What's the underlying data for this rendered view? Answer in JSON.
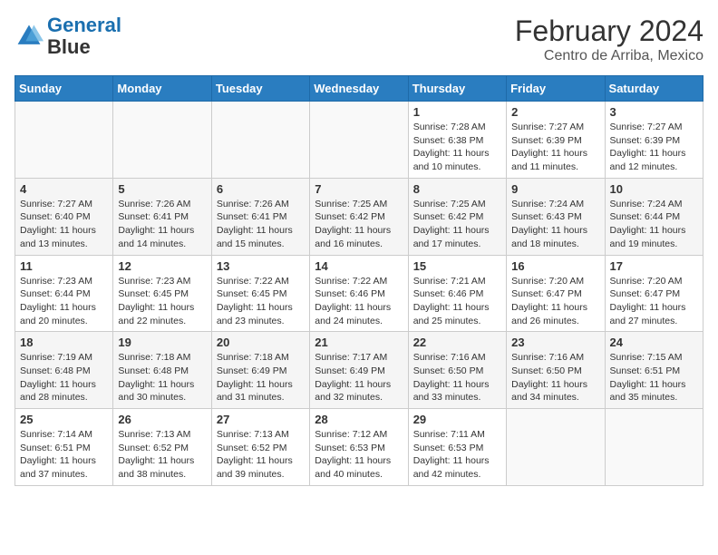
{
  "logo": {
    "line1": "General",
    "line2": "Blue"
  },
  "title": "February 2024",
  "subtitle": "Centro de Arriba, Mexico",
  "days_of_week": [
    "Sunday",
    "Monday",
    "Tuesday",
    "Wednesday",
    "Thursday",
    "Friday",
    "Saturday"
  ],
  "weeks": [
    [
      {
        "day": "",
        "empty": true
      },
      {
        "day": "",
        "empty": true
      },
      {
        "day": "",
        "empty": true
      },
      {
        "day": "",
        "empty": true
      },
      {
        "day": "1",
        "sunrise": "7:28 AM",
        "sunset": "6:38 PM",
        "daylight": "11 hours and 10 minutes."
      },
      {
        "day": "2",
        "sunrise": "7:27 AM",
        "sunset": "6:39 PM",
        "daylight": "11 hours and 11 minutes."
      },
      {
        "day": "3",
        "sunrise": "7:27 AM",
        "sunset": "6:39 PM",
        "daylight": "11 hours and 12 minutes."
      }
    ],
    [
      {
        "day": "4",
        "sunrise": "7:27 AM",
        "sunset": "6:40 PM",
        "daylight": "11 hours and 13 minutes."
      },
      {
        "day": "5",
        "sunrise": "7:26 AM",
        "sunset": "6:41 PM",
        "daylight": "11 hours and 14 minutes."
      },
      {
        "day": "6",
        "sunrise": "7:26 AM",
        "sunset": "6:41 PM",
        "daylight": "11 hours and 15 minutes."
      },
      {
        "day": "7",
        "sunrise": "7:25 AM",
        "sunset": "6:42 PM",
        "daylight": "11 hours and 16 minutes."
      },
      {
        "day": "8",
        "sunrise": "7:25 AM",
        "sunset": "6:42 PM",
        "daylight": "11 hours and 17 minutes."
      },
      {
        "day": "9",
        "sunrise": "7:24 AM",
        "sunset": "6:43 PM",
        "daylight": "11 hours and 18 minutes."
      },
      {
        "day": "10",
        "sunrise": "7:24 AM",
        "sunset": "6:44 PM",
        "daylight": "11 hours and 19 minutes."
      }
    ],
    [
      {
        "day": "11",
        "sunrise": "7:23 AM",
        "sunset": "6:44 PM",
        "daylight": "11 hours and 20 minutes."
      },
      {
        "day": "12",
        "sunrise": "7:23 AM",
        "sunset": "6:45 PM",
        "daylight": "11 hours and 22 minutes."
      },
      {
        "day": "13",
        "sunrise": "7:22 AM",
        "sunset": "6:45 PM",
        "daylight": "11 hours and 23 minutes."
      },
      {
        "day": "14",
        "sunrise": "7:22 AM",
        "sunset": "6:46 PM",
        "daylight": "11 hours and 24 minutes."
      },
      {
        "day": "15",
        "sunrise": "7:21 AM",
        "sunset": "6:46 PM",
        "daylight": "11 hours and 25 minutes."
      },
      {
        "day": "16",
        "sunrise": "7:20 AM",
        "sunset": "6:47 PM",
        "daylight": "11 hours and 26 minutes."
      },
      {
        "day": "17",
        "sunrise": "7:20 AM",
        "sunset": "6:47 PM",
        "daylight": "11 hours and 27 minutes."
      }
    ],
    [
      {
        "day": "18",
        "sunrise": "7:19 AM",
        "sunset": "6:48 PM",
        "daylight": "11 hours and 28 minutes."
      },
      {
        "day": "19",
        "sunrise": "7:18 AM",
        "sunset": "6:48 PM",
        "daylight": "11 hours and 30 minutes."
      },
      {
        "day": "20",
        "sunrise": "7:18 AM",
        "sunset": "6:49 PM",
        "daylight": "11 hours and 31 minutes."
      },
      {
        "day": "21",
        "sunrise": "7:17 AM",
        "sunset": "6:49 PM",
        "daylight": "11 hours and 32 minutes."
      },
      {
        "day": "22",
        "sunrise": "7:16 AM",
        "sunset": "6:50 PM",
        "daylight": "11 hours and 33 minutes."
      },
      {
        "day": "23",
        "sunrise": "7:16 AM",
        "sunset": "6:50 PM",
        "daylight": "11 hours and 34 minutes."
      },
      {
        "day": "24",
        "sunrise": "7:15 AM",
        "sunset": "6:51 PM",
        "daylight": "11 hours and 35 minutes."
      }
    ],
    [
      {
        "day": "25",
        "sunrise": "7:14 AM",
        "sunset": "6:51 PM",
        "daylight": "11 hours and 37 minutes."
      },
      {
        "day": "26",
        "sunrise": "7:13 AM",
        "sunset": "6:52 PM",
        "daylight": "11 hours and 38 minutes."
      },
      {
        "day": "27",
        "sunrise": "7:13 AM",
        "sunset": "6:52 PM",
        "daylight": "11 hours and 39 minutes."
      },
      {
        "day": "28",
        "sunrise": "7:12 AM",
        "sunset": "6:53 PM",
        "daylight": "11 hours and 40 minutes."
      },
      {
        "day": "29",
        "sunrise": "7:11 AM",
        "sunset": "6:53 PM",
        "daylight": "11 hours and 42 minutes."
      },
      {
        "day": "",
        "empty": true
      },
      {
        "day": "",
        "empty": true
      }
    ]
  ],
  "labels": {
    "sunrise": "Sunrise:",
    "sunset": "Sunset:",
    "daylight": "Daylight:"
  }
}
